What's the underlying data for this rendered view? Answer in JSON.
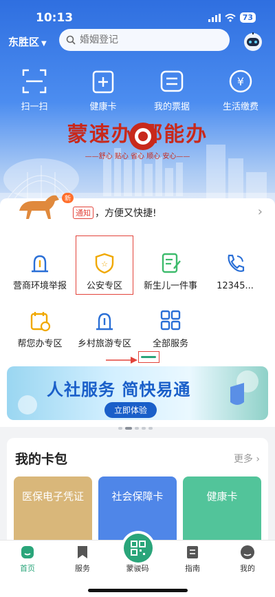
{
  "status": {
    "time": "10:13",
    "battery": "73"
  },
  "header": {
    "region": "东胜区",
    "search_placeholder": "婚姻登记"
  },
  "quick_actions": [
    {
      "label": "扫一扫",
      "icon": "scan-icon"
    },
    {
      "label": "健康卡",
      "icon": "health-card-icon"
    },
    {
      "label": "我的票据",
      "icon": "receipt-icon"
    },
    {
      "label": "生活缴费",
      "icon": "payment-icon"
    }
  ],
  "slogan": {
    "main": "蒙速办 鄂能办",
    "sub": "——舒心  贴心  省心  顺心  安心——"
  },
  "notice": {
    "badge": "新",
    "tag": "通知",
    "text": "，方便又快捷!"
  },
  "services": [
    {
      "label": "营商环境举报",
      "icon": "alarm-light-icon"
    },
    {
      "label": "公安专区",
      "icon": "police-shield-icon"
    },
    {
      "label": "新生儿一件事",
      "icon": "document-edit-icon"
    },
    {
      "label": "12345...",
      "icon": "phone-icon"
    },
    {
      "label": "帮您办专区",
      "icon": "calendar-clock-icon"
    },
    {
      "label": "乡村旅游专区",
      "icon": "alarm-light-icon"
    },
    {
      "label": "全部服务",
      "icon": "grid-icon"
    }
  ],
  "banner": {
    "title": "人社服务 简快易通",
    "button": "立即体验"
  },
  "wallet": {
    "title": "我的卡包",
    "more": "更多",
    "cards": [
      {
        "label": "医保电子凭证",
        "color": "#d9b77a"
      },
      {
        "label": "社会保障卡",
        "color": "#4f86e8"
      },
      {
        "label": "健康卡",
        "color": "#52c49a"
      }
    ]
  },
  "tabbar": [
    {
      "label": "首页",
      "icon": "home-icon",
      "active": true
    },
    {
      "label": "服务",
      "icon": "bookmark-icon",
      "active": false
    },
    {
      "label": "蒙骏码",
      "icon": "qr-code-icon",
      "active": false
    },
    {
      "label": "指南",
      "icon": "guide-icon",
      "active": false
    },
    {
      "label": "我的",
      "icon": "profile-icon",
      "active": false
    }
  ],
  "colors": {
    "brand_green": "#2aa57a",
    "accent_red": "#e2433a",
    "sky_blue": "#2f6fe0"
  }
}
